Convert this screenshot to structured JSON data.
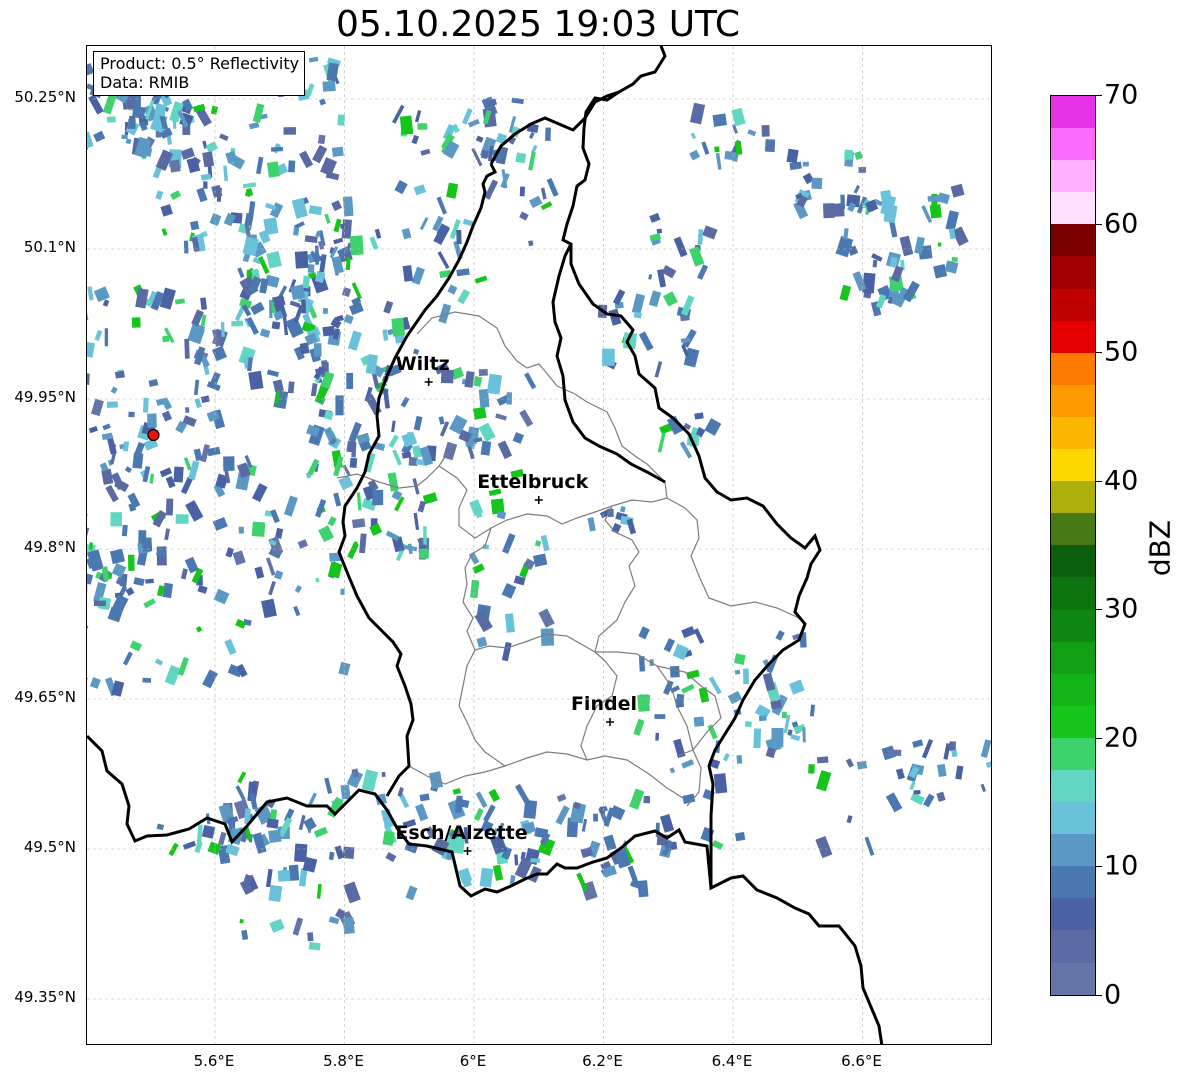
{
  "title": "05.10.2025 19:03 UTC",
  "info": {
    "product": "Product: 0.5° Reflectivity",
    "source": "Data: RMIB"
  },
  "axes": {
    "lat_ticks": [
      "50.25°N",
      "50.1°N",
      "49.95°N",
      "49.8°N",
      "49.65°N",
      "49.5°N",
      "49.35°N"
    ],
    "lon_ticks": [
      "5.6°E",
      "5.8°E",
      "6°E",
      "6.2°E",
      "6.4°E",
      "6.6°E"
    ],
    "lat_values": [
      50.25,
      50.1,
      49.95,
      49.8,
      49.65,
      49.5,
      49.35
    ],
    "lon_values": [
      5.6,
      5.8,
      6.0,
      6.2,
      6.4,
      6.6
    ]
  },
  "cities": [
    {
      "name": "Wiltz",
      "lon": 5.93,
      "lat": 49.967
    },
    {
      "name": "Ettelbruck",
      "lon": 6.1,
      "lat": 49.849
    },
    {
      "name": "Findel",
      "lon": 6.21,
      "lat": 49.627
    },
    {
      "name": "Esch/Alzette",
      "lon": 5.99,
      "lat": 49.498
    }
  ],
  "radar_site": {
    "lon": 5.505,
    "lat": 49.914,
    "color": "#e8120c"
  },
  "colorbar": {
    "label": "dBZ",
    "min": 0,
    "max": 70,
    "ticks": [
      "0",
      "10",
      "20",
      "30",
      "40",
      "50",
      "60",
      "70"
    ],
    "colors": [
      "#6476a8",
      "#5a6aa3",
      "#4a62a3",
      "#4b78b0",
      "#5b99c4",
      "#69c2da",
      "#63d6c3",
      "#3ed26c",
      "#16c51a",
      "#12b418",
      "#109f15",
      "#0e8712",
      "#0c740f",
      "#0a5e0c",
      "#477a15",
      "#afaf0b",
      "#fdd700",
      "#fdb700",
      "#fd9a00",
      "#fd7c00",
      "#e40000",
      "#c00000",
      "#a20000",
      "#7a0000",
      "#ffe0ff",
      "#ffb0ff",
      "#fb6bfb",
      "#e733e7"
    ]
  }
}
